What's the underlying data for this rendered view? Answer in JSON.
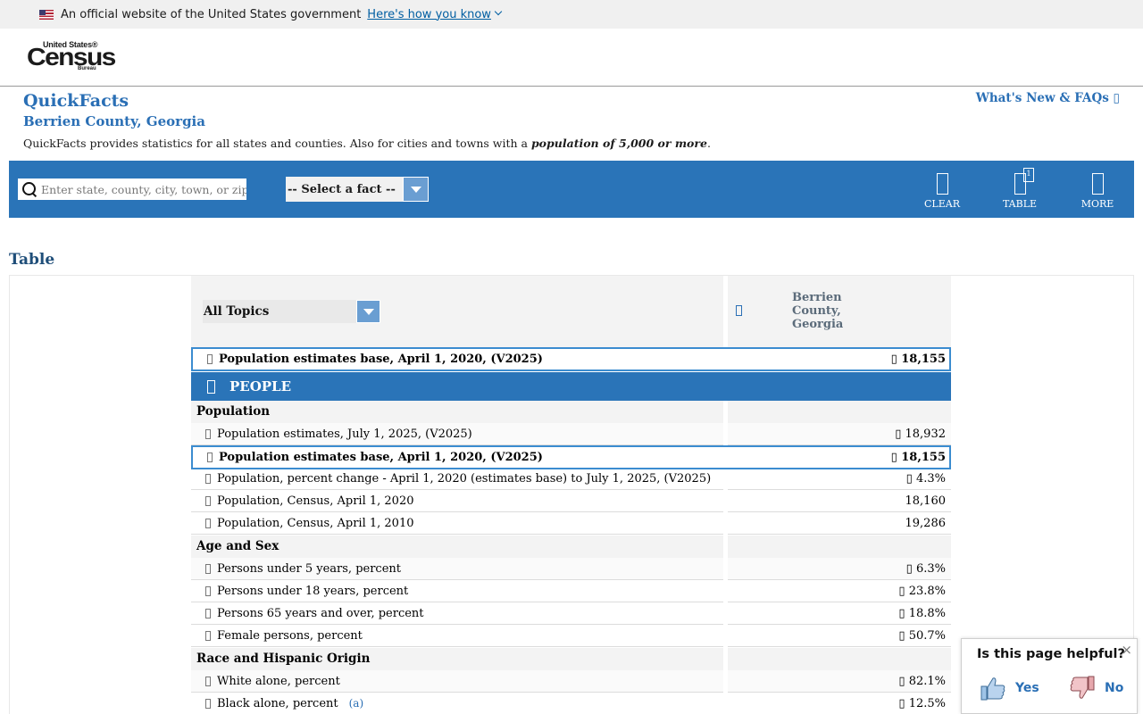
{
  "gov_banner": {
    "text": "An official website of the United States government",
    "link": "Here's how you know"
  },
  "logo": {
    "line1": "United States®",
    "line2": "Census",
    "line3": "Bureau"
  },
  "quickfacts": {
    "title": "QuickFacts",
    "location": "Berrien County, Georgia",
    "desc_pre": "QuickFacts provides statistics for all states and counties. Also for cities and towns with a ",
    "desc_bold": "population of 5,000 or more",
    "desc_post": ".",
    "whats_new": "What's New & FAQs ▯"
  },
  "toolbar": {
    "search_placeholder": "Enter state, county, city, town, or zip code",
    "select_label": "-- Select a fact --",
    "clear": "CLEAR",
    "table": "TABLE",
    "table_badge": "1",
    "more": "MORE"
  },
  "table": {
    "heading": "Table",
    "topics_label": "All Topics",
    "county_line1": "Berrien",
    "county_line2": "County,",
    "county_line3": "Georgia",
    "pinned": {
      "label": "Population estimates base, April 1, 2020, (V2025)",
      "value": "▯ 18,155"
    },
    "people_header": "PEOPLE",
    "sections": {
      "population": "Population",
      "age_sex": "Age and Sex",
      "race": "Race and Hispanic Origin"
    },
    "rows": [
      {
        "label": "Population estimates, July 1, 2025, (V2025)",
        "value": "▯ 18,932"
      },
      {
        "label": "Population estimates base, April 1, 2020, (V2025)",
        "value": "▯ 18,155"
      },
      {
        "label": "Population, percent change - April 1, 2020 (estimates base) to July 1, 2025, (V2025)",
        "value": "▯ 4.3%"
      },
      {
        "label": "Population, Census, April 1, 2020",
        "value": "18,160"
      },
      {
        "label": "Population, Census, April 1, 2010",
        "value": "19,286"
      },
      {
        "label": "Persons under 5 years, percent",
        "value": "▯ 6.3%"
      },
      {
        "label": "Persons under 18 years, percent",
        "value": "▯ 23.8%"
      },
      {
        "label": "Persons 65 years and over, percent",
        "value": "▯ 18.8%"
      },
      {
        "label": "Female persons, percent",
        "value": "▯ 50.7%"
      },
      {
        "label": "White alone, percent",
        "value": "▯ 82.1%"
      },
      {
        "label": "Black alone, percent",
        "value": "▯ 12.5%",
        "footnote": "(a)"
      }
    ]
  },
  "feedback": {
    "question": "Is this page helpful?",
    "yes": "Yes",
    "no": "No",
    "close": "×"
  }
}
